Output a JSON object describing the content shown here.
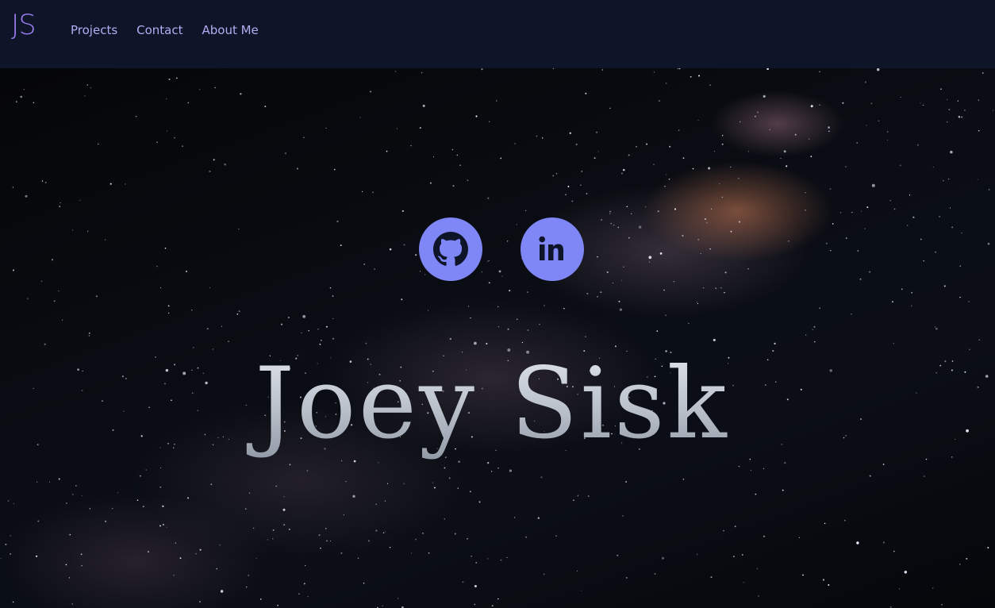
{
  "header": {
    "logo": "JS",
    "nav": [
      {
        "label": "Projects"
      },
      {
        "label": "Contact"
      },
      {
        "label": "About Me"
      }
    ]
  },
  "hero": {
    "name": "Joey Sisk",
    "social": [
      {
        "icon": "github-icon"
      },
      {
        "icon": "linkedin-icon",
        "text": "in"
      }
    ]
  },
  "colors": {
    "navbar_bg": "#0e1528",
    "logo": "#9d7cf2",
    "nav_link": "#b4acf2",
    "social_button": "#7f86f6",
    "name_text": "#cfd4dc"
  }
}
